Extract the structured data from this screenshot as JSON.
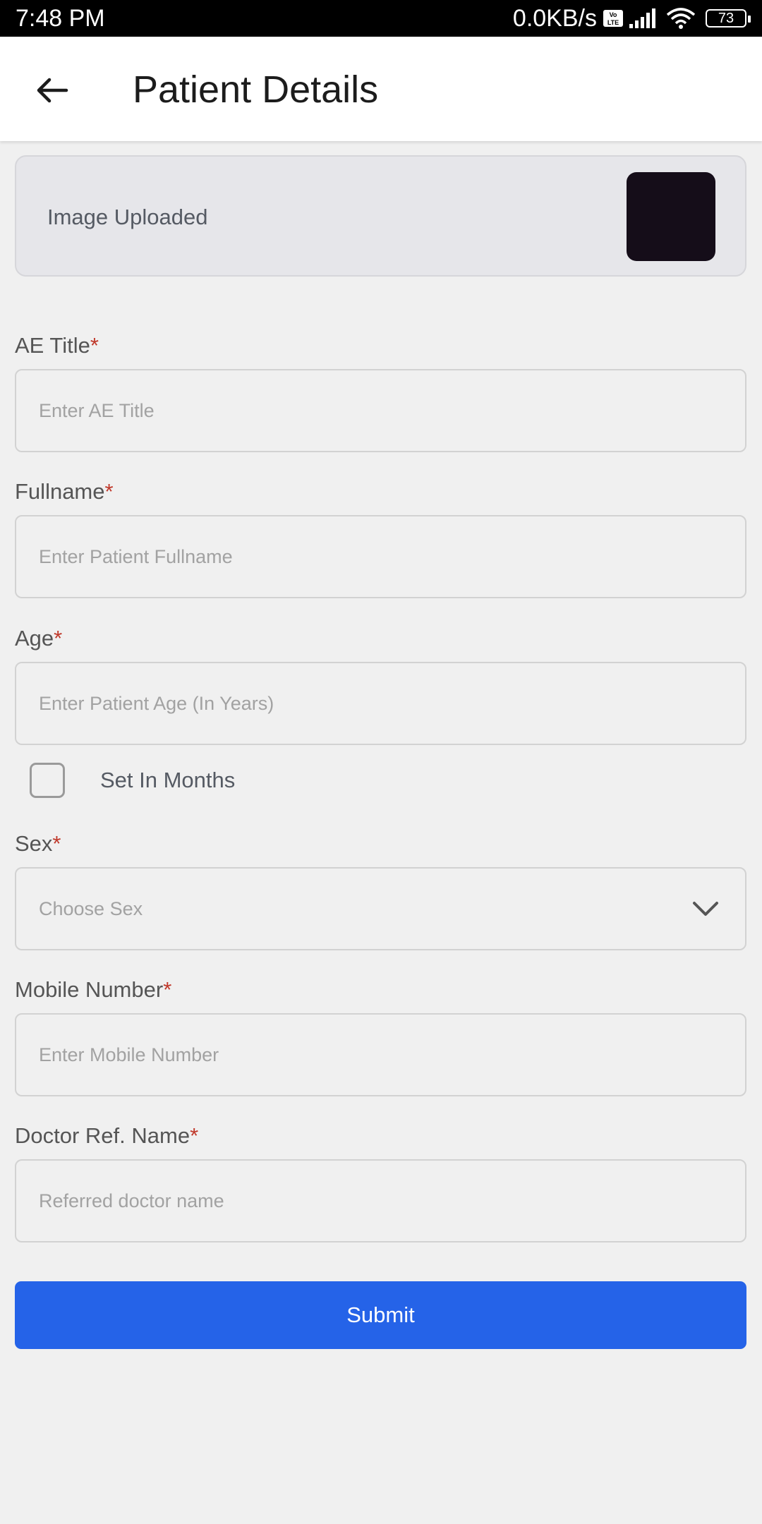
{
  "status_bar": {
    "time": "7:48 PM",
    "network_speed": "0.0KB/s",
    "volte_label": "Vo LTE",
    "battery": "73"
  },
  "app_bar": {
    "back_icon": "arrow-left-icon",
    "title": "Patient Details"
  },
  "upload": {
    "label": "Image Uploaded"
  },
  "form": {
    "ae_title": {
      "label": "AE Title",
      "required_mark": "*",
      "placeholder": "Enter AE Title",
      "value": ""
    },
    "fullname": {
      "label": "Fullname",
      "required_mark": "*",
      "placeholder": "Enter Patient Fullname",
      "value": ""
    },
    "age": {
      "label": "Age",
      "required_mark": "*",
      "placeholder": "Enter Patient Age (In Years)",
      "value": ""
    },
    "months_checkbox": {
      "label": "Set In Months",
      "checked": false
    },
    "sex": {
      "label": "Sex",
      "required_mark": "*",
      "placeholder": "Choose Sex",
      "icon": "chevron-down-icon"
    },
    "mobile": {
      "label": "Mobile Number",
      "required_mark": "*",
      "placeholder": "Enter Mobile Number",
      "value": ""
    },
    "doctor_ref": {
      "label": "Doctor Ref. Name",
      "required_mark": "*",
      "placeholder": "Referred doctor name",
      "value": ""
    }
  },
  "submit_label": "Submit",
  "colors": {
    "primary": "#2563e8",
    "required": "#c0392b",
    "background": "#f0f0f0"
  }
}
